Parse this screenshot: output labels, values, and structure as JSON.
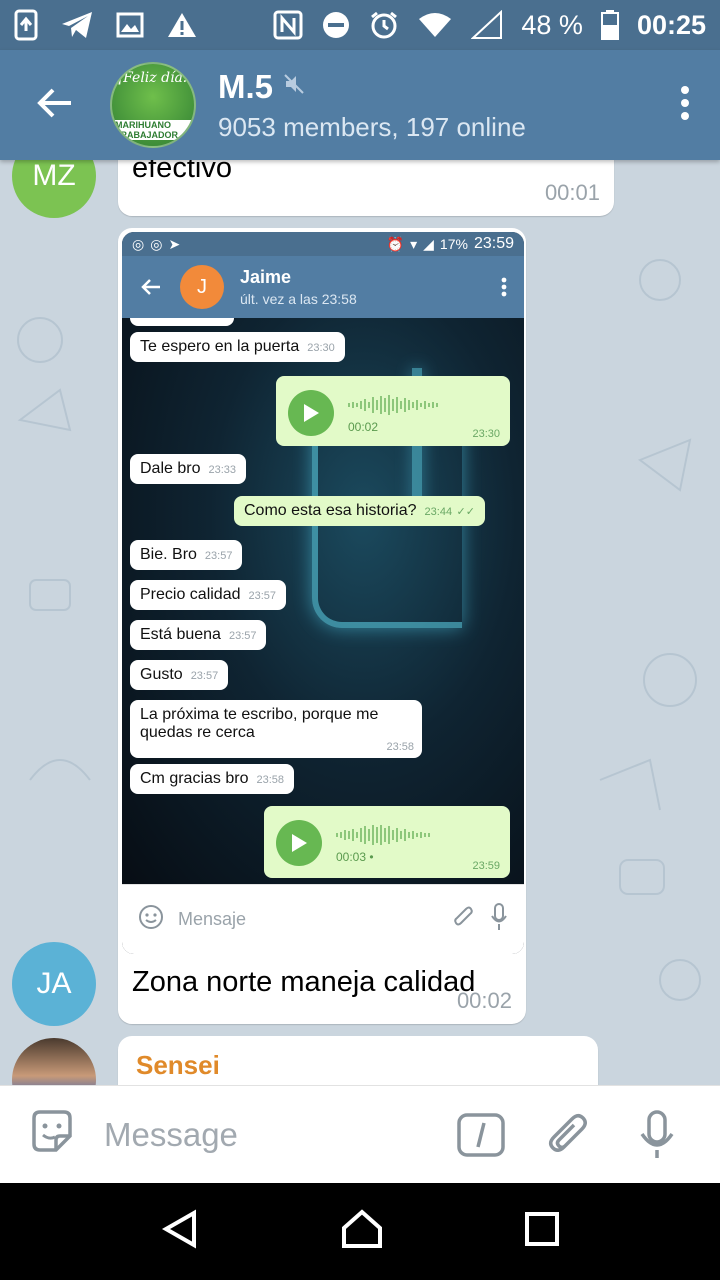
{
  "status_bar": {
    "battery_percent": "48 %",
    "time": "00:25"
  },
  "header": {
    "group_name": "M.5",
    "subtitle": "9053 members, 197 online",
    "avatar_line1": "¡Feliz día!",
    "avatar_line2": "MARIHUANO TRABAJADOR"
  },
  "messages": [
    {
      "avatar_initials": "MZ",
      "avatar_color": "#7cc352",
      "text": "efectivo",
      "time": "00:01"
    },
    {
      "avatar_initials": "JA",
      "avatar_color": "#5bb2d6",
      "caption": "Zona norte maneja calidad",
      "time": "00:02",
      "embedded": {
        "status_battery": "17%",
        "status_time": "23:59",
        "contact_name": "Jaime",
        "contact_initial": "J",
        "last_seen": "últ. vez a las 23:58",
        "input_placeholder": "Mensaje",
        "chat": [
          {
            "text": "Te espero en la puerta",
            "time": "23:30"
          },
          {
            "voice": true,
            "duration": "00:02",
            "time": "23:30"
          },
          {
            "text": "Dale bro",
            "time": "23:33"
          },
          {
            "text": "Como esta esa historia?",
            "time": "23:44",
            "out": true
          },
          {
            "text": "Bie. Bro",
            "time": "23:57"
          },
          {
            "text": "Precio calidad",
            "time": "23:57"
          },
          {
            "text": "Está buena",
            "time": "23:57"
          },
          {
            "text": "Gusto",
            "time": "23:57"
          },
          {
            "text": "La próxima te escribo, porque me quedas re cerca",
            "time": "23:58"
          },
          {
            "text": "Cm gracias bro",
            "time": "23:58"
          },
          {
            "voice": true,
            "duration": "00:03",
            "time": "23:59"
          }
        ]
      }
    },
    {
      "sender_name": "Sensei",
      "sender_color": "#e08a2a"
    }
  ],
  "input": {
    "placeholder": "Message"
  },
  "icons": {
    "back": "arrow-left-icon",
    "mute": "mute-icon",
    "menu": "more-vert-icon",
    "sticker": "sticker-icon",
    "command": "slash-command-icon",
    "attach": "paperclip-icon",
    "mic": "microphone-icon"
  },
  "colors": {
    "header": "#527da3",
    "status_bar": "#4a6f8f",
    "chat_bg": "#cad5de",
    "outgoing_bubble": "#e2fac8"
  }
}
